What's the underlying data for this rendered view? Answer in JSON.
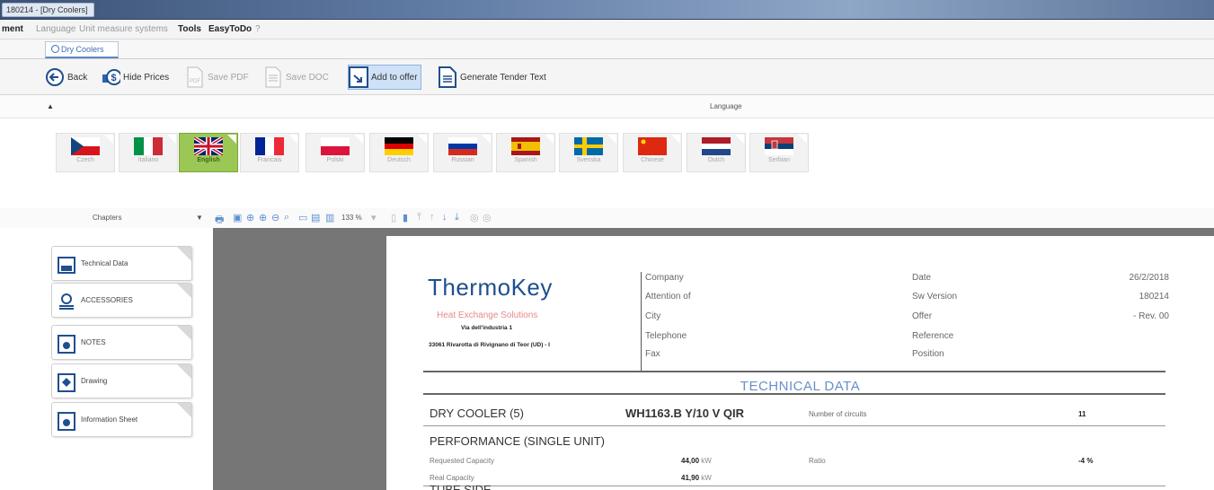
{
  "window": {
    "title": "180214 - [Dry Coolers]"
  },
  "menu": [
    "ment",
    "Language",
    "Unit measure systems",
    "Tools",
    "EasyToDo",
    "?"
  ],
  "doc_tab": {
    "label": "Dry Coolers"
  },
  "toolbar": {
    "back": "Back",
    "hide_prices": "Hide Prices",
    "save_pdf": "Save PDF",
    "save_doc": "Save DOC",
    "add_to_offer": "Add to offer",
    "generate_tender": "Generate Tender Text"
  },
  "language": {
    "header": "Language",
    "collapse": "▲",
    "flags": [
      {
        "label": "Czech",
        "code": "cz"
      },
      {
        "label": "Italiano",
        "code": "it"
      },
      {
        "label": "English",
        "code": "gb"
      },
      {
        "label": "Francais",
        "code": "fr"
      },
      {
        "label": "Polski",
        "code": "pl"
      },
      {
        "label": "Deutsch",
        "code": "de"
      },
      {
        "label": "Russian",
        "code": "ru"
      },
      {
        "label": "Spanish",
        "code": "es"
      },
      {
        "label": "Svenska",
        "code": "se"
      },
      {
        "label": "Chinese",
        "code": "cn"
      },
      {
        "label": "Dutch",
        "code": "nl"
      },
      {
        "label": "Serbian",
        "code": "rs"
      }
    ],
    "selected": "English"
  },
  "chapters": {
    "header": "Chapters",
    "pin": "▼",
    "items": [
      "Technical Data",
      "ACCESSORIES",
      "NOTES",
      "Drawing",
      "Information Sheet"
    ]
  },
  "viewer": {
    "zoom": "133 %"
  },
  "document": {
    "logo": "ThermoKey",
    "slogan": "Heat Exchange Solutions",
    "address1": "Via dell'industria 1",
    "address2": "33061 Rivarotta di Rivignano di Teor (UD) - I",
    "left_fields": [
      "Company",
      "Attention of",
      "City",
      "Telephone",
      "Fax"
    ],
    "right_fields": [
      {
        "label": "Date",
        "value": "26/2/2018"
      },
      {
        "label": "Sw Version",
        "value": "180214"
      },
      {
        "label": "Offer",
        "value": "- Rev. 00"
      },
      {
        "label": "Reference",
        "value": ""
      },
      {
        "label": "Position",
        "value": ""
      }
    ],
    "section_title": "TECHNICAL DATA",
    "dry_cooler_label": "DRY COOLER (5)",
    "model": "WH1163.B Y/10 V QIR",
    "circuits_label": "Number of circuits",
    "circuits_value": "11",
    "performance_title": "PERFORMANCE (SINGLE UNIT)",
    "requested_capacity_label": "Requested Capacity",
    "requested_capacity_value": "44,00",
    "real_capacity_label": "Real Capacity",
    "real_capacity_value": "41,90",
    "unit_kw": "kW",
    "ratio_label": "Ratio",
    "ratio_value": "-4 %",
    "cut_off_heading": "TUBE SIDE"
  },
  "colors": {
    "accent_selected": "#9bc855",
    "title_bar": "#4a6389",
    "doc_heading_blue": "#6a8fc8",
    "logo_blue": "#1f4f8e"
  }
}
